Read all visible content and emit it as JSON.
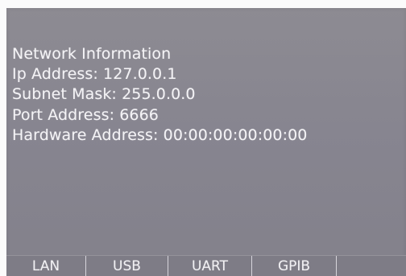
{
  "network_info": {
    "title": "Network Information",
    "ip_address": "Ip Address: 127.0.0.1",
    "subnet_mask": "Subnet Mask: 255.0.0.0",
    "port_address": "Port Address: 6666",
    "hardware_address": "Hardware Address: 00:00:00:00:00:00"
  },
  "tabs": [
    {
      "label": "LAN"
    },
    {
      "label": "USB"
    },
    {
      "label": "UART"
    },
    {
      "label": "GPIB"
    }
  ],
  "colors": {
    "panel_bg": "#8a8891",
    "text": "#f4f3f6",
    "tab_separator": "#d7d5dc"
  }
}
